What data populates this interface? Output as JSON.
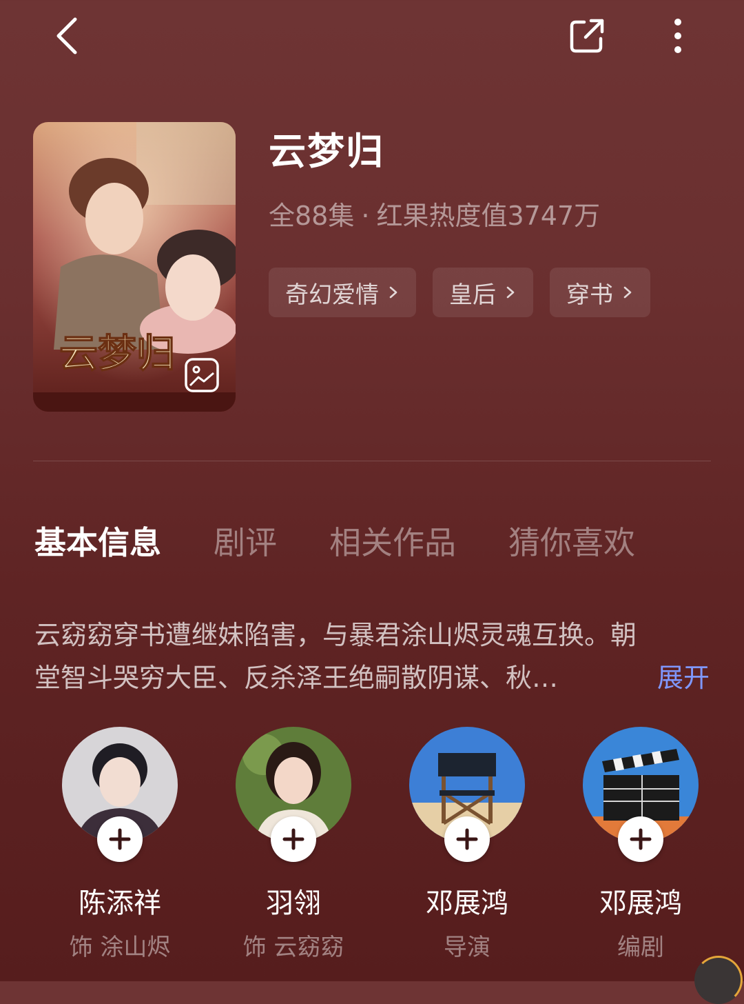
{
  "header": {
    "back_icon": "chevron-left-icon",
    "share_icon": "share-external-icon",
    "more_icon": "more-vertical-icon"
  },
  "show": {
    "title": "云梦归",
    "episodes": "全88集",
    "separator": "·",
    "heat": "红果热度值3747万",
    "tags": [
      {
        "label": "奇幻爱情"
      },
      {
        "label": "皇后"
      },
      {
        "label": "穿书"
      }
    ]
  },
  "tabs": [
    {
      "label": "基本信息",
      "active": true
    },
    {
      "label": "剧评",
      "active": false
    },
    {
      "label": "相关作品",
      "active": false
    },
    {
      "label": "猜你喜欢",
      "active": false
    }
  ],
  "synopsis": {
    "line1": "云窈窈穿书遭继妹陷害，与暴君涂山烬灵魂互换。朝",
    "line2": "堂智斗哭穷大臣、反杀泽王绝嗣散阴谋、秋…",
    "expand_label": "展开"
  },
  "cast": [
    {
      "name": "陈添祥",
      "role": "饰 涂山烬",
      "avatar": "actor-photo"
    },
    {
      "name": "羽翎",
      "role": "饰 云窈窈",
      "avatar": "actress-photo"
    },
    {
      "name": "邓展鸿",
      "role": "导演",
      "avatar": "director-chair-icon"
    },
    {
      "name": "邓展鸿",
      "role": "编剧",
      "avatar": "clapperboard-icon"
    }
  ],
  "colors": {
    "background": "#6a2f2f",
    "accent_link": "#7f98ff",
    "tag_bg": "rgba(255,255,255,0.09)"
  }
}
